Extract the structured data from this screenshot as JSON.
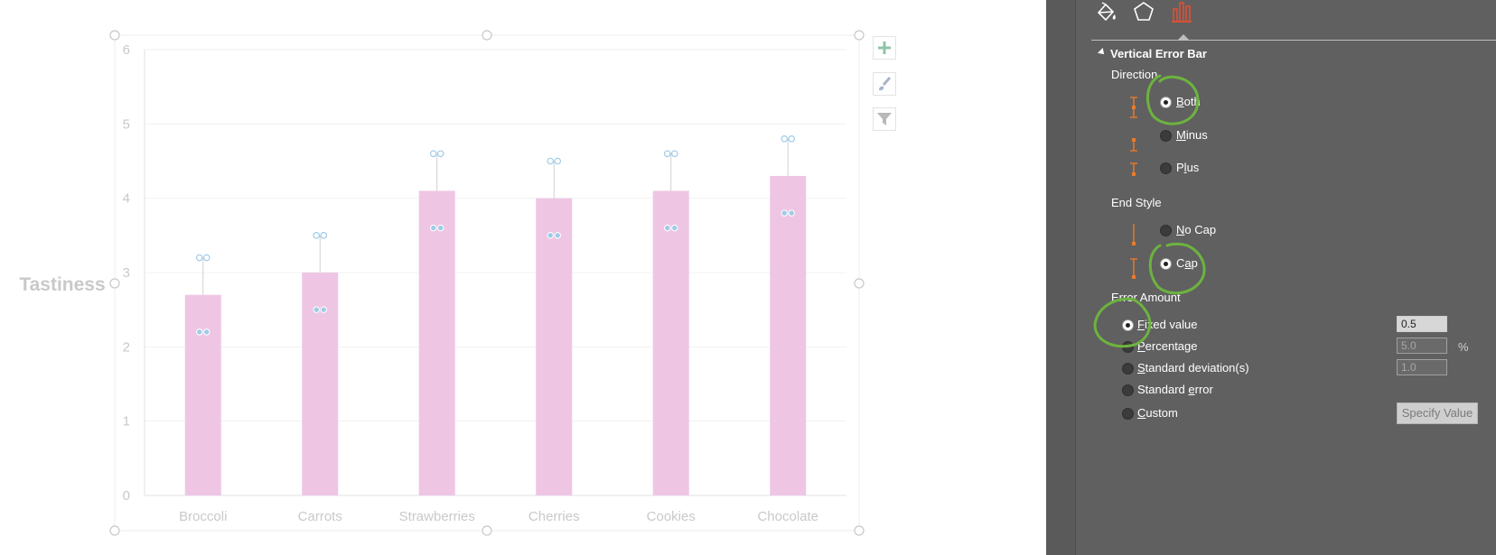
{
  "chart_data": {
    "type": "bar",
    "categories": [
      "Broccoli",
      "Carrots",
      "Strawberries",
      "Cherries",
      "Cookies",
      "Chocolate"
    ],
    "values": [
      2.7,
      3.0,
      4.1,
      4.0,
      4.1,
      4.3
    ],
    "error_plus_minus": 0.5,
    "ylabel": "Tastiness",
    "ylim": [
      0,
      6
    ],
    "yticks": [
      "0",
      "1",
      "2",
      "3",
      "4",
      "5",
      "6"
    ],
    "grid": true,
    "colors": {
      "bar": "#eec6e4",
      "error_bar": "#d0d0d0",
      "handle": "#9ecbe8"
    }
  },
  "pane": {
    "section_title": "Vertical Error Bar",
    "direction": {
      "title": "Direction",
      "options": [
        {
          "label": "Both",
          "accel": "B",
          "checked": true
        },
        {
          "label": "Minus",
          "accel": "M",
          "checked": false
        },
        {
          "label": "Plus",
          "accel": "l",
          "checked": false
        }
      ]
    },
    "end_style": {
      "title": "End Style",
      "options": [
        {
          "label": "No Cap",
          "accel": "N",
          "checked": false
        },
        {
          "label": "Cap",
          "accel": "a",
          "checked": true
        }
      ]
    },
    "error_amount": {
      "title": "Error Amount",
      "options": [
        {
          "label": "Fixed value",
          "accel": "F",
          "checked": true,
          "input": "0.5",
          "enabled": true
        },
        {
          "label": "Percentage",
          "accel": "P",
          "checked": false,
          "input": "5.0",
          "suffix": "%",
          "enabled": false
        },
        {
          "label": "Standard deviation(s)",
          "accel": "S",
          "checked": false,
          "input": "1.0",
          "enabled": false
        },
        {
          "label": "Standard error",
          "accel": "e",
          "checked": false
        },
        {
          "label": "Custom",
          "accel": "C",
          "checked": false
        }
      ],
      "specify_value": "Specify Value"
    }
  },
  "colors": {
    "pane_bg": "#606060",
    "accent_orange": "#e87b2c",
    "annotation_green": "#6db33f",
    "tab_red": "#e34f32"
  },
  "icons": [
    "fill-line-icon",
    "effects-pentagon-icon",
    "bar-chart-options-icon",
    "chart-elements-plus-icon",
    "chart-styles-brush-icon",
    "chart-filter-icon"
  ]
}
